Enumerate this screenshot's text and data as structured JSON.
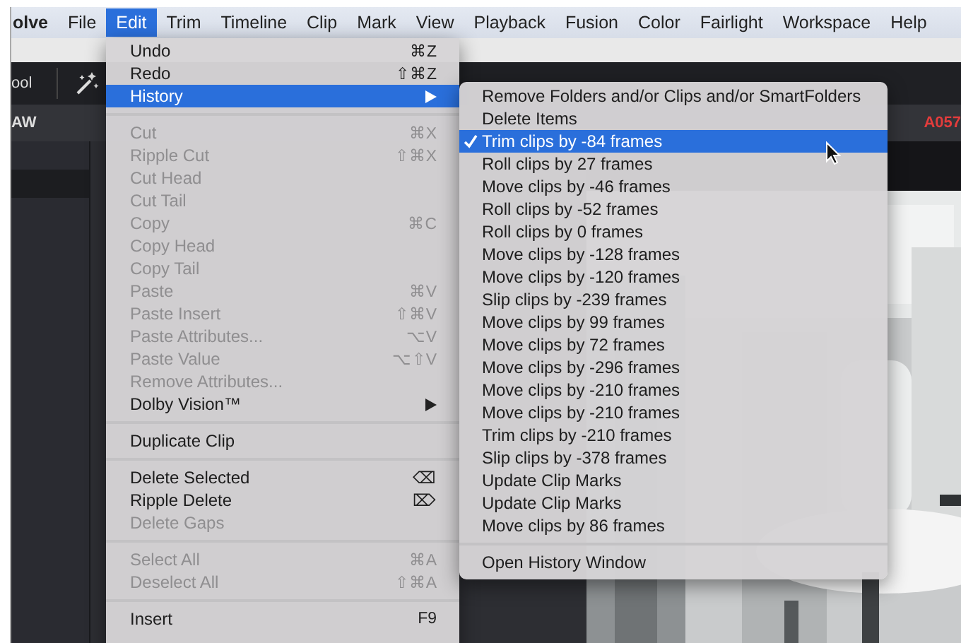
{
  "menubar": {
    "app_name": "olve",
    "items": [
      {
        "label": "File",
        "selected": false
      },
      {
        "label": "Edit",
        "selected": true
      },
      {
        "label": "Trim",
        "selected": false
      },
      {
        "label": "Timeline",
        "selected": false
      },
      {
        "label": "Clip",
        "selected": false
      },
      {
        "label": "Mark",
        "selected": false
      },
      {
        "label": "View",
        "selected": false
      },
      {
        "label": "Playback",
        "selected": false
      },
      {
        "label": "Fusion",
        "selected": false
      },
      {
        "label": "Color",
        "selected": false
      },
      {
        "label": "Fairlight",
        "selected": false
      },
      {
        "label": "Workspace",
        "selected": false
      },
      {
        "label": "Help",
        "selected": false
      }
    ]
  },
  "toolbar": {
    "panel_label": "ool"
  },
  "header": {
    "panel_label": "AW",
    "clip_name": "A057"
  },
  "edit_menu": [
    {
      "kind": "item",
      "label": "Undo",
      "shortcut": "⌘Z",
      "disabled": false,
      "selected": false
    },
    {
      "kind": "item",
      "label": "Redo",
      "shortcut": "⇧⌘Z",
      "disabled": false,
      "selected": false
    },
    {
      "kind": "submenu",
      "label": "History",
      "disabled": false,
      "selected": true
    },
    {
      "kind": "separator"
    },
    {
      "kind": "item",
      "label": "Cut",
      "shortcut": "⌘X",
      "disabled": true,
      "selected": false
    },
    {
      "kind": "item",
      "label": "Ripple Cut",
      "shortcut": "⇧⌘X",
      "disabled": true,
      "selected": false
    },
    {
      "kind": "item",
      "label": "Cut Head",
      "disabled": true,
      "selected": false
    },
    {
      "kind": "item",
      "label": "Cut Tail",
      "disabled": true,
      "selected": false
    },
    {
      "kind": "item",
      "label": "Copy",
      "shortcut": "⌘C",
      "disabled": true,
      "selected": false
    },
    {
      "kind": "item",
      "label": "Copy Head",
      "disabled": true,
      "selected": false
    },
    {
      "kind": "item",
      "label": "Copy Tail",
      "disabled": true,
      "selected": false
    },
    {
      "kind": "item",
      "label": "Paste",
      "shortcut": "⌘V",
      "disabled": true,
      "selected": false
    },
    {
      "kind": "item",
      "label": "Paste Insert",
      "shortcut": "⇧⌘V",
      "disabled": true,
      "selected": false
    },
    {
      "kind": "item",
      "label": "Paste Attributes...",
      "shortcut": "⌥V",
      "disabled": true,
      "selected": false
    },
    {
      "kind": "item",
      "label": "Paste Value",
      "shortcut": "⌥⇧V",
      "disabled": true,
      "selected": false
    },
    {
      "kind": "item",
      "label": "Remove Attributes...",
      "disabled": true,
      "selected": false
    },
    {
      "kind": "submenu",
      "label": "Dolby Vision™",
      "disabled": false,
      "selected": false
    },
    {
      "kind": "separator"
    },
    {
      "kind": "item",
      "label": "Duplicate Clip",
      "disabled": false,
      "selected": false
    },
    {
      "kind": "separator"
    },
    {
      "kind": "item",
      "label": "Delete Selected",
      "shortcut": "⌫",
      "disabled": false,
      "selected": false
    },
    {
      "kind": "item",
      "label": "Ripple Delete",
      "shortcut": "⌦",
      "disabled": false,
      "selected": false
    },
    {
      "kind": "item",
      "label": "Delete Gaps",
      "disabled": true,
      "selected": false
    },
    {
      "kind": "separator"
    },
    {
      "kind": "item",
      "label": "Select All",
      "shortcut": "⌘A",
      "disabled": true,
      "selected": false
    },
    {
      "kind": "item",
      "label": "Deselect All",
      "shortcut": "⇧⌘A",
      "disabled": true,
      "selected": false
    },
    {
      "kind": "separator"
    },
    {
      "kind": "item",
      "label": "Insert",
      "shortcut": "F9",
      "disabled": false,
      "selected": false
    }
  ],
  "history_menu": [
    {
      "kind": "item",
      "label": "Remove Folders and/or Clips and/or SmartFolders",
      "checked": false,
      "selected": false
    },
    {
      "kind": "item",
      "label": "Delete Items",
      "checked": false,
      "selected": false
    },
    {
      "kind": "item",
      "label": "Trim clips by -84 frames",
      "checked": true,
      "selected": true
    },
    {
      "kind": "item",
      "label": "Roll clips by 27 frames",
      "checked": false,
      "selected": false
    },
    {
      "kind": "item",
      "label": "Move clips by -46 frames",
      "checked": false,
      "selected": false
    },
    {
      "kind": "item",
      "label": "Roll clips by -52 frames",
      "checked": false,
      "selected": false
    },
    {
      "kind": "item",
      "label": "Roll clips by 0 frames",
      "checked": false,
      "selected": false
    },
    {
      "kind": "item",
      "label": "Move clips by -128 frames",
      "checked": false,
      "selected": false
    },
    {
      "kind": "item",
      "label": "Move clips by -120 frames",
      "checked": false,
      "selected": false
    },
    {
      "kind": "item",
      "label": "Slip clips by -239 frames",
      "checked": false,
      "selected": false
    },
    {
      "kind": "item",
      "label": "Move clips by 99 frames",
      "checked": false,
      "selected": false
    },
    {
      "kind": "item",
      "label": "Move clips by 72 frames",
      "checked": false,
      "selected": false
    },
    {
      "kind": "item",
      "label": "Move clips by -296 frames",
      "checked": false,
      "selected": false
    },
    {
      "kind": "item",
      "label": "Move clips by -210 frames",
      "checked": false,
      "selected": false
    },
    {
      "kind": "item",
      "label": "Move clips by -210 frames",
      "checked": false,
      "selected": false
    },
    {
      "kind": "item",
      "label": "Trim clips by -210 frames",
      "checked": false,
      "selected": false
    },
    {
      "kind": "item",
      "label": "Slip clips by -378 frames",
      "checked": false,
      "selected": false
    },
    {
      "kind": "item",
      "label": "Update Clip Marks",
      "checked": false,
      "selected": false
    },
    {
      "kind": "item",
      "label": "Update Clip Marks",
      "checked": false,
      "selected": false
    },
    {
      "kind": "item",
      "label": "Move clips by 86 frames",
      "checked": false,
      "selected": false
    },
    {
      "kind": "separator"
    },
    {
      "kind": "item",
      "label": "Open History Window",
      "checked": false,
      "selected": false
    }
  ]
}
